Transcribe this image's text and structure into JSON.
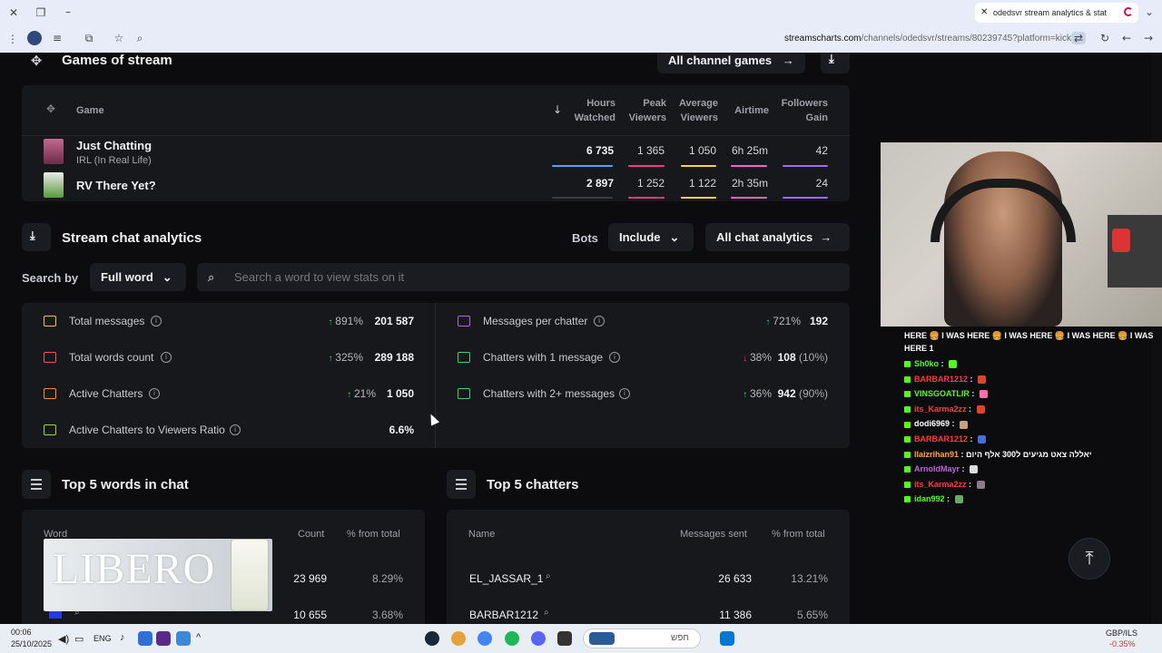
{
  "browser": {
    "tab_title": "odedsvr stream analytics & stat",
    "url_domain": "streamscharts.com",
    "url_path": "/channels/odedsvr/streams/80239745?platform=kick"
  },
  "games_section": {
    "title": "Games of stream",
    "all_games_label": "All channel games",
    "headers": {
      "game": "Game",
      "hours_watched": [
        "Hours",
        "Watched"
      ],
      "peak_viewers": [
        "Peak",
        "Viewers"
      ],
      "average_viewers": [
        "Average",
        "Viewers"
      ],
      "airtime": "Airtime",
      "followers_gain": [
        "Followers",
        "Gain"
      ]
    },
    "rows": [
      {
        "name": "Just Chatting",
        "subtitle": "IRL (In Real Life)",
        "hours_watched": "6 735",
        "peak_viewers": "1 365",
        "average_viewers": "1 050",
        "airtime": "6h 25m",
        "followers_gain": "42"
      },
      {
        "name": "RV There Yet?",
        "subtitle": "",
        "hours_watched": "2 897",
        "peak_viewers": "1 252",
        "average_viewers": "1 122",
        "airtime": "2h 35m",
        "followers_gain": "24"
      }
    ],
    "line_colors": {
      "hours": "#4da3ff",
      "peak": "#ff3b7a",
      "average": "#ffd43b",
      "airtime": "#ff5fd1",
      "followers": "#9a6bff"
    }
  },
  "chat_section": {
    "title": "Stream chat analytics",
    "bots_label": "Bots",
    "bots_value": "Include",
    "all_chat_label": "All chat analytics",
    "search_by_label": "Search by",
    "search_mode": "Full word",
    "search_placeholder": "Search a word to view stats on it",
    "stats_left": [
      {
        "label": "Total messages",
        "pct": "891%",
        "dir": "up",
        "value": "201 587",
        "sub": "",
        "icon_color": "#f5c542"
      },
      {
        "label": "Total words count",
        "pct": "325%",
        "dir": "up",
        "value": "289 188",
        "sub": "",
        "icon_color": "#ff4d5e"
      },
      {
        "label": "Active Chatters",
        "pct": "21%",
        "dir": "up",
        "value": "1 050",
        "sub": "",
        "icon_color": "#ff8a3d"
      },
      {
        "label": "Active Chatters to Viewers Ratio",
        "pct": "",
        "dir": "",
        "value": "6.6%",
        "sub": "",
        "icon_color": "#a5d63b"
      }
    ],
    "stats_right": [
      {
        "label": "Messages per chatter",
        "pct": "721%",
        "dir": "up",
        "value": "192",
        "sub": "",
        "icon_color": "#c35fe0"
      },
      {
        "label": "Chatters with 1 message",
        "pct": "38%",
        "dir": "down",
        "value": "108",
        "sub": "(10%)",
        "icon_color": "#44d17a"
      },
      {
        "label": "Chatters with 2+ messages",
        "pct": "36%",
        "dir": "up",
        "value": "942",
        "sub": "(90%)",
        "icon_color": "#44d17a"
      }
    ]
  },
  "top_words": {
    "title": "Top 5 words in chat",
    "headers": {
      "word": "Word",
      "count": "Count",
      "pct": "% from total"
    },
    "rows": [
      {
        "word": "",
        "count": "23 969",
        "pct": "8.29%"
      },
      {
        "word": "",
        "count": "10 655",
        "pct": "3.68%"
      }
    ],
    "ad_text": "LIBERO"
  },
  "top_chatters": {
    "title": "Top 5 chatters",
    "headers": {
      "name": "Name",
      "messages": "Messages sent",
      "pct": "% from total"
    },
    "rows": [
      {
        "name": "EL_JASSAR_1",
        "messages": "26 633",
        "pct": "13.21%"
      },
      {
        "name": "BARBAR1212",
        "messages": "11 386",
        "pct": "5.65%"
      }
    ]
  },
  "chat_overlay": {
    "header": "HERE 🍔 I WAS HERE 🍔 I WAS HERE 🍔 I WAS HERE 🍔 I WAS HERE 1",
    "lines": [
      {
        "user": "Sh0ko",
        "color": "#53fc18",
        "msg": ""
      },
      {
        "user": "BARBAR1212",
        "color": "#ff3b3b",
        "msg": ""
      },
      {
        "user": "VINSGOATLIR",
        "color": "#53fc18",
        "msg": ""
      },
      {
        "user": "its_Karma2zz",
        "color": "#ff3b3b",
        "msg": ""
      },
      {
        "user": "dodi6969",
        "color": "#ffffff",
        "msg": ""
      },
      {
        "user": "BARBAR1212",
        "color": "#ff3b3b",
        "msg": ""
      },
      {
        "user": "llaizrihan91",
        "color": "#ffa53b",
        "msg": "יאללה צאט מגיעים ל300 אלף היום"
      },
      {
        "user": "ArnoldMayr",
        "color": "#c35fe0",
        "msg": ""
      },
      {
        "user": "its_Karma2zz",
        "color": "#ff3b3b",
        "msg": ""
      },
      {
        "user": "idan992",
        "color": "#53fc18",
        "msg": ""
      }
    ]
  },
  "taskbar": {
    "time": "00:06",
    "date": "25/10/2025",
    "lang": "ENG",
    "search_placeholder": "חפש",
    "ticker": "GBP/ILS",
    "ticker_change": "-0.35%"
  }
}
